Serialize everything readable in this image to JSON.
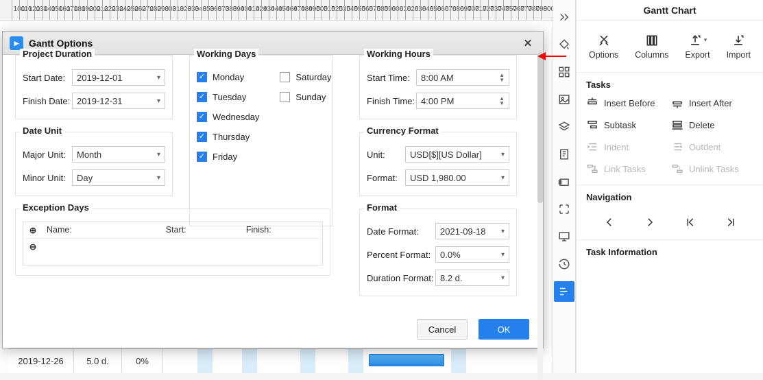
{
  "ruler": {
    "start": 100,
    "end": 800,
    "step": 10
  },
  "dialog": {
    "title": "Gantt Options",
    "projectDuration": {
      "legend": "Project Duration",
      "startLabel": "Start Date:",
      "startValue": "2019-12-01",
      "finishLabel": "Finish Date:",
      "finishValue": "2019-12-31"
    },
    "dateUnit": {
      "legend": "Date Unit",
      "majorLabel": "Major Unit:",
      "majorValue": "Month",
      "minorLabel": "Minor Unit:",
      "minorValue": "Day"
    },
    "exception": {
      "legend": "Exception Days",
      "nameHeader": "Name:",
      "startHeader": "Start:",
      "finishHeader": "Finish:"
    },
    "workingDays": {
      "legend": "Working Days",
      "monday": "Monday",
      "tuesday": "Tuesday",
      "wednesday": "Wednesday",
      "thursday": "Thursday",
      "friday": "Friday",
      "saturday": "Saturday",
      "sunday": "Sunday"
    },
    "workingHours": {
      "legend": "Working Hours",
      "startLabel": "Start Time:",
      "startValue": "8:00 AM",
      "finishLabel": "Finish Time:",
      "finishValue": "4:00 PM"
    },
    "currency": {
      "legend": "Currency Format",
      "unitLabel": "Unit:",
      "unitValue": "USD[$][US Dollar]",
      "formatLabel": "Format:",
      "formatValue": "USD 1,980.00"
    },
    "format": {
      "legend": "Format",
      "dateFormatLabel": "Date Format:",
      "dateFormatValue": "2021-09-18",
      "percentLabel": "Percent Format:",
      "percentValue": "0.0%",
      "durationLabel": "Duration Format:",
      "durationValue": "8.2 d."
    },
    "cancel": "Cancel",
    "ok": "OK"
  },
  "ganttRow": {
    "date": "2019-12-26",
    "duration": "5.0 d.",
    "progress": "0%"
  },
  "panel": {
    "title": "Gantt Chart",
    "options": "Options",
    "columns": "Columns",
    "export": "Export",
    "import": "Import",
    "tasksHeader": "Tasks",
    "insertBefore": "Insert Before",
    "insertAfter": "Insert After",
    "subtask": "Subtask",
    "delete": "Delete",
    "indent": "Indent",
    "outdent": "Outdent",
    "linkTasks": "Link Tasks",
    "unlinkTasks": "Unlink Tasks",
    "navigation": "Navigation",
    "taskInformation": "Task Information"
  }
}
